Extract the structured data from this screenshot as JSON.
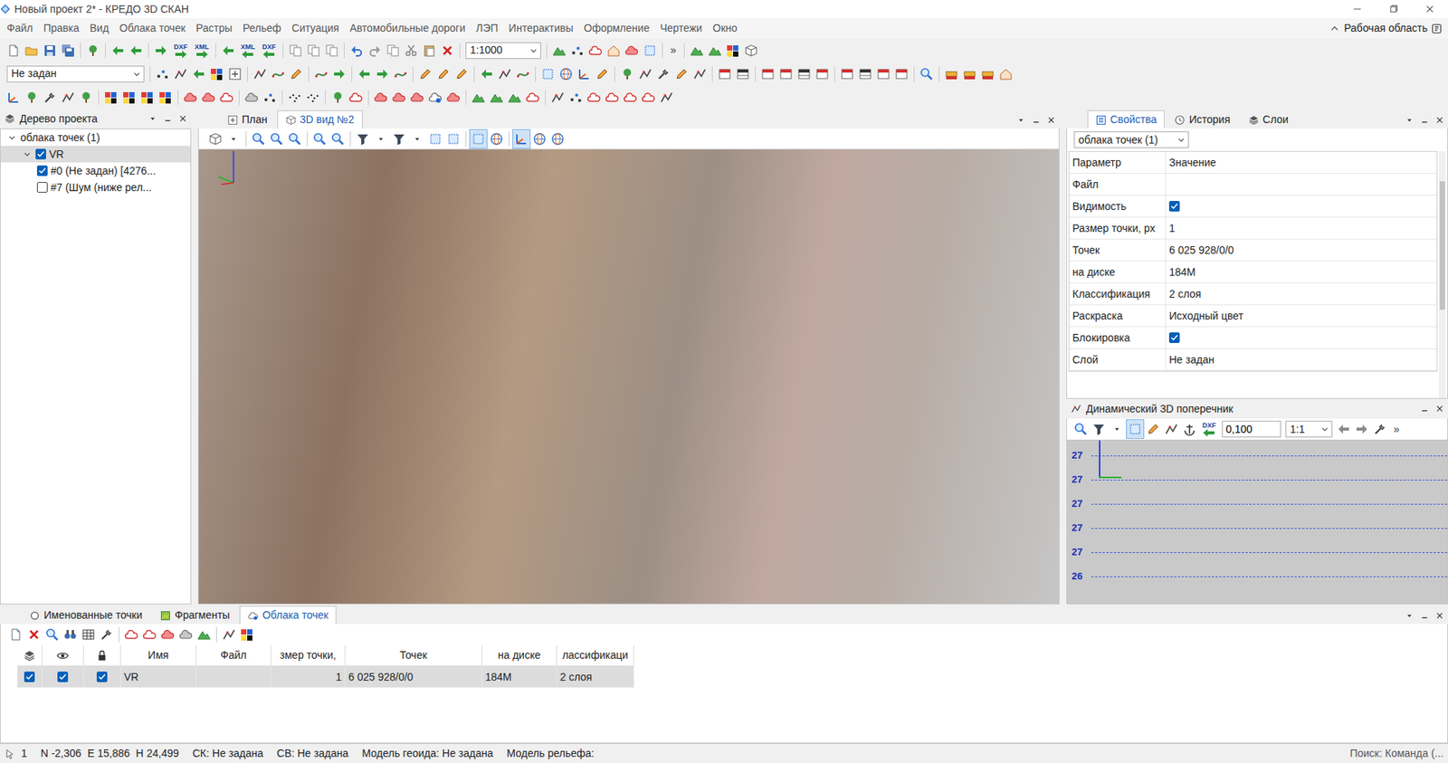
{
  "window": {
    "title": "Новый проект 2* - КРЕДО 3D СКАН"
  },
  "menu": {
    "items": [
      "Файл",
      "Правка",
      "Вид",
      "Облака точек",
      "Растры",
      "Рельеф",
      "Ситуация",
      "Автомобильные дороги",
      "ЛЭП",
      "Интерактивы",
      "Оформление",
      "Чертежи",
      "Окно"
    ],
    "workspace": "Рабочая область"
  },
  "toolbars": {
    "standard": {
      "scale": "1:1000",
      "badges": [
        "DXF",
        "XML",
        "XML",
        "DXF"
      ],
      "overflow": "»"
    },
    "layer": {
      "value": "Не задан"
    }
  },
  "project_tree": {
    "title": "Дерево проекта",
    "items": [
      {
        "label": "облака точек (1)",
        "depth": 0,
        "expanded": true,
        "selected": false
      },
      {
        "label": "VR",
        "depth": 1,
        "expanded": true,
        "checked": true,
        "selected": true
      },
      {
        "label": "#0 (Не задан) [4276...",
        "depth": 2,
        "checked": true,
        "selected": false
      },
      {
        "label": "#7 (Шум (ниже рел...",
        "depth": 2,
        "checked": false,
        "selected": false
      }
    ]
  },
  "view_tabs": [
    {
      "label": "План",
      "selected": false
    },
    {
      "label": "3D вид №2",
      "selected": true
    }
  ],
  "properties": {
    "tabs": [
      {
        "label": "Свойства",
        "selected": true
      },
      {
        "label": "История",
        "selected": false
      },
      {
        "label": "Слои",
        "selected": false
      }
    ],
    "object": "облака точек (1)",
    "header": [
      "Параметр",
      "Значение"
    ],
    "rows": [
      {
        "name": "Файл",
        "kind": "text",
        "value": ""
      },
      {
        "name": "Видимость",
        "kind": "check",
        "checked": true
      },
      {
        "name": "Размер точки, px",
        "kind": "text",
        "value": "1"
      },
      {
        "name": "Точек",
        "kind": "text",
        "value": "6 025 928/0/0"
      },
      {
        "name": "на диске",
        "kind": "text",
        "value": "184M"
      },
      {
        "name": "Классификация",
        "kind": "text",
        "value": "2 слоя"
      },
      {
        "name": "Раскраска",
        "kind": "text",
        "value": "Исходный цвет"
      },
      {
        "name": "Блокировка",
        "kind": "check",
        "checked": true
      },
      {
        "name": "Слой",
        "kind": "text",
        "value": "Не задан"
      }
    ]
  },
  "cross_section": {
    "title": "Динамический 3D поперечник",
    "badge": "DXF",
    "step": "0,100",
    "scale": "1:1",
    "overflow": "»",
    "ticks": [
      "27",
      "27",
      "27",
      "27",
      "27",
      "26"
    ]
  },
  "bottom_tabs": [
    {
      "label": "Именованные точки",
      "selected": false
    },
    {
      "label": "Фрагменты",
      "selected": false
    },
    {
      "label": "Облака точек",
      "selected": true
    }
  ],
  "clouds_table": {
    "columns": [
      "Имя",
      "Файл",
      "змер точки,",
      "Точек",
      "на диске",
      "лассификаци"
    ],
    "rows": [
      {
        "selected": true,
        "layer": true,
        "visible": true,
        "locked": true,
        "cells": [
          "VR",
          "",
          "1",
          "6 025 928/0/0",
          "184M",
          "2 слоя"
        ]
      }
    ]
  },
  "status_bar": {
    "count": "1",
    "coords": [
      {
        "axis": "N",
        "value": "-2,306"
      },
      {
        "axis": "E",
        "value": "15,886"
      },
      {
        "axis": "H",
        "value": "24,499"
      }
    ],
    "fields": [
      "СК: Не задана",
      "СВ: Не задана",
      "Модель геоида: Не задана",
      "Модель рельефа:"
    ],
    "search": "Поиск: Команда (..."
  }
}
